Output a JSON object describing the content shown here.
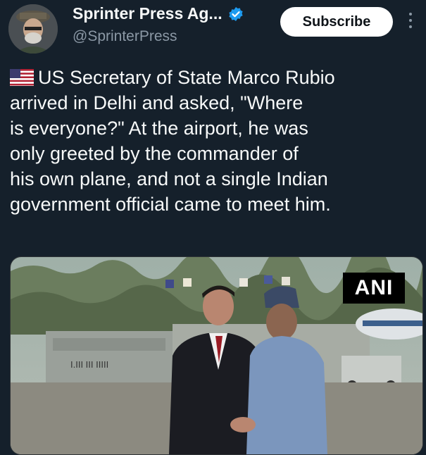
{
  "tweet": {
    "author": {
      "display_name": "Sprinter Press Ag...",
      "handle": "@SprinterPress",
      "verified_icon": "verified-badge-icon",
      "avatar_icon": "avatar-icon"
    },
    "subscribe_label": "Subscribe",
    "more_icon": "more-options-icon",
    "flag_icon": "us-flag-icon",
    "text_lines": [
      "US Secretary of State Marco Rubio",
      "arrived in Delhi and asked, \"Where",
      "is everyone?\" At the airport, he was",
      "only greeted by the commander of",
      "his own plane, and not a single Indian",
      "government official came to meet him."
    ],
    "media": {
      "watermark": "ANI"
    }
  },
  "colors": {
    "background": "#15202b",
    "text": "#f7f9f9",
    "secondary_text": "#8b98a5",
    "verified": "#1d9bf0",
    "subscribe_bg": "#ffffff"
  }
}
